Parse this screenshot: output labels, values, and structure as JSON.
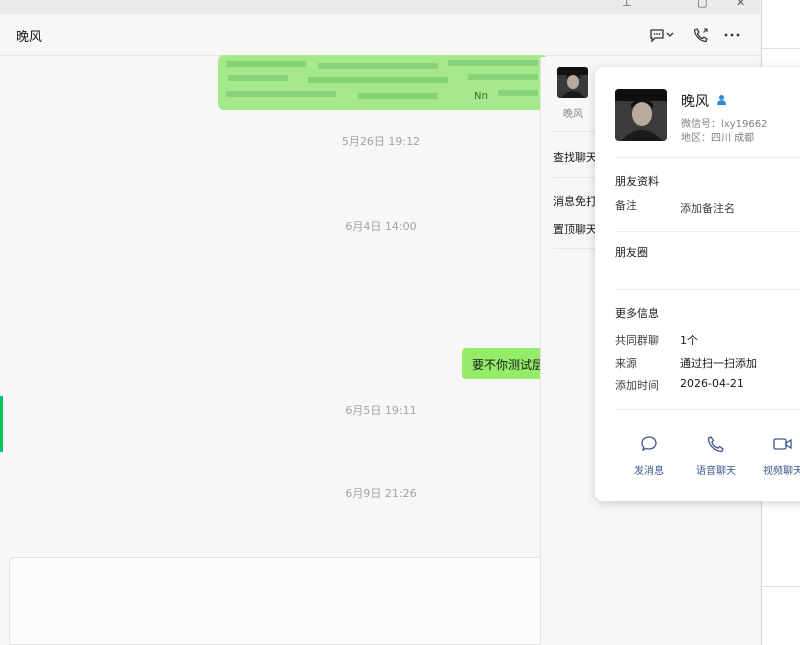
{
  "chat": {
    "title": "晚风",
    "blurred_tail": "Nп",
    "timestamps": [
      "5月26日 19:12",
      "6月4日 14:00",
      "6月5日 19:11",
      "6月9日 21:26"
    ],
    "outgoing_message": "要不你测试层"
  },
  "side_panel": {
    "member_name": "晚风",
    "rows": [
      "查找聊天",
      "消息免打",
      "置顶聊天"
    ]
  },
  "profile_card": {
    "name": "晚风",
    "wechat_id": "微信号：lxy19662",
    "region": "地区：四川 成都",
    "section_profile": "朋友资料",
    "remark_key": "备注",
    "remark_value": "添加备注名",
    "moments_label": "朋友圈",
    "more_info": "更多信息",
    "common_groups_key": "共同群聊",
    "common_groups_value": "1个",
    "source_key": "来源",
    "source_value": "通过扫一扫添加",
    "added_time_key": "添加时间",
    "added_time_value": "2026-04-21",
    "actions": [
      {
        "icon": "chat-bubble-icon",
        "label": "发消息"
      },
      {
        "icon": "phone-icon",
        "label": "语音聊天"
      },
      {
        "icon": "video-camera-icon",
        "label": "视频聊天"
      }
    ]
  },
  "colors": {
    "accent_green": "#07c160",
    "bubble_green": "#95ec69",
    "action_blue": "#3a5a8c"
  }
}
